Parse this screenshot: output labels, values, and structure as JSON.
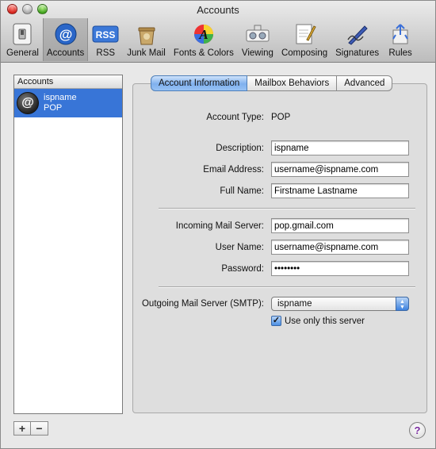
{
  "window": {
    "title": "Accounts"
  },
  "toolbar": {
    "items": [
      {
        "label": "General",
        "icon": "switch-icon"
      },
      {
        "label": "Accounts",
        "icon": "at-sign-icon",
        "selected": true
      },
      {
        "label": "RSS",
        "icon": "rss-icon"
      },
      {
        "label": "Junk Mail",
        "icon": "junk-mail-icon"
      },
      {
        "label": "Fonts & Colors",
        "icon": "fonts-colors-icon"
      },
      {
        "label": "Viewing",
        "icon": "viewing-icon"
      },
      {
        "label": "Composing",
        "icon": "composing-icon"
      },
      {
        "label": "Signatures",
        "icon": "signatures-icon"
      },
      {
        "label": "Rules",
        "icon": "rules-icon"
      }
    ]
  },
  "accounts": {
    "header": "Accounts",
    "items": [
      {
        "name": "ispname",
        "type": "POP",
        "icon": "at-sign-icon",
        "selected": true
      }
    ],
    "add_label": "+",
    "remove_label": "−"
  },
  "tabs": [
    {
      "label": "Account Information",
      "active": true
    },
    {
      "label": "Mailbox Behaviors"
    },
    {
      "label": "Advanced"
    }
  ],
  "form": {
    "account_type_label": "Account Type:",
    "account_type_value": "POP",
    "description_label": "Description:",
    "description_value": "ispname",
    "email_label": "Email Address:",
    "email_value": "username@ispname.com",
    "fullname_label": "Full Name:",
    "fullname_value": "Firstname Lastname",
    "incoming_label": "Incoming Mail Server:",
    "incoming_value": "pop.gmail.com",
    "username_label": "User Name:",
    "username_value": "username@ispname.com",
    "password_label": "Password:",
    "password_value": "••••••••",
    "smtp_label": "Outgoing Mail Server (SMTP):",
    "smtp_value": "ispname",
    "only_server_label": "Use only this server",
    "only_server_checked": true
  },
  "help": {
    "label": "?"
  },
  "colors": {
    "selection": "#3875d7",
    "tab_active": "#7fb0ee"
  }
}
